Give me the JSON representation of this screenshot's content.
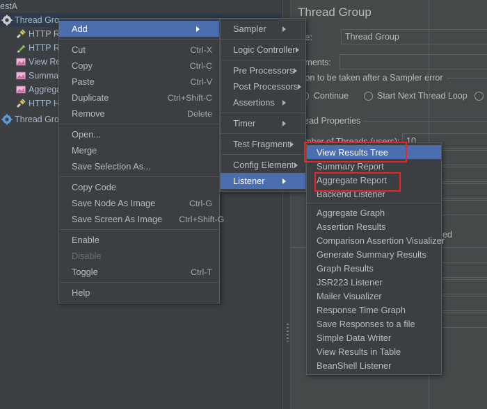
{
  "app": {
    "tree_root_label": "estA"
  },
  "tree": {
    "items": [
      {
        "label": "Thread Group",
        "icon": "gear-icon",
        "selected": true,
        "indent": 0
      },
      {
        "label": "HTTP Re",
        "icon": "http-request-icon",
        "selected": false,
        "indent": 1
      },
      {
        "label": "HTTP Re",
        "icon": "http-request-defaults-icon",
        "selected": false,
        "indent": 1
      },
      {
        "label": "View Res",
        "icon": "listener-icon",
        "selected": false,
        "indent": 1
      },
      {
        "label": "Summar",
        "icon": "listener-icon",
        "selected": false,
        "indent": 1
      },
      {
        "label": "Aggrega",
        "icon": "listener-icon",
        "selected": false,
        "indent": 1
      },
      {
        "label": "HTTP He",
        "icon": "http-header-manager-icon",
        "selected": false,
        "indent": 1
      },
      {
        "label": "Thread Grou",
        "icon": "gear-blue-icon",
        "selected": false,
        "indent": 0
      }
    ]
  },
  "config": {
    "title": "Thread Group",
    "name_label": "me:",
    "name_value": "Thread Group",
    "comments_label": "mments:",
    "comments_value": "",
    "sampler_error_group": "ction to be taken after a Sampler error",
    "radio_continue": "Continue",
    "radio_start_next_loop": "Start Next Thread Loop",
    "thread_properties_group": "hread Properties",
    "num_threads_label": "Jumber of Threads (users):",
    "num_threads_value": "10",
    "forever_partial": "ed"
  },
  "context_menu": {
    "items": [
      {
        "label": "Add",
        "accel": "",
        "submenu": true,
        "selected": true,
        "disabled": false
      },
      {
        "separator": true
      },
      {
        "label": "Cut",
        "accel": "Ctrl-X",
        "submenu": false,
        "selected": false,
        "disabled": false
      },
      {
        "label": "Copy",
        "accel": "Ctrl-C",
        "submenu": false,
        "selected": false,
        "disabled": false
      },
      {
        "label": "Paste",
        "accel": "Ctrl-V",
        "submenu": false,
        "selected": false,
        "disabled": false
      },
      {
        "label": "Duplicate",
        "accel": "Ctrl+Shift-C",
        "submenu": false,
        "selected": false,
        "disabled": false
      },
      {
        "label": "Remove",
        "accel": "Delete",
        "submenu": false,
        "selected": false,
        "disabled": false
      },
      {
        "separator": true
      },
      {
        "label": "Open...",
        "accel": "",
        "submenu": false,
        "selected": false,
        "disabled": false
      },
      {
        "label": "Merge",
        "accel": "",
        "submenu": false,
        "selected": false,
        "disabled": false
      },
      {
        "label": "Save Selection As...",
        "accel": "",
        "submenu": false,
        "selected": false,
        "disabled": false
      },
      {
        "separator": true
      },
      {
        "label": "Copy Code",
        "accel": "",
        "submenu": false,
        "selected": false,
        "disabled": false
      },
      {
        "label": "Save Node As Image",
        "accel": "Ctrl-G",
        "submenu": false,
        "selected": false,
        "disabled": false
      },
      {
        "label": "Save Screen As Image",
        "accel": "Ctrl+Shift-G",
        "submenu": false,
        "selected": false,
        "disabled": false
      },
      {
        "separator": true
      },
      {
        "label": "Enable",
        "accel": "",
        "submenu": false,
        "selected": false,
        "disabled": false
      },
      {
        "label": "Disable",
        "accel": "",
        "submenu": false,
        "selected": false,
        "disabled": true
      },
      {
        "label": "Toggle",
        "accel": "Ctrl-T",
        "submenu": false,
        "selected": false,
        "disabled": false
      },
      {
        "separator": true
      },
      {
        "label": "Help",
        "accel": "",
        "submenu": false,
        "selected": false,
        "disabled": false
      }
    ]
  },
  "add_submenu": {
    "items": [
      {
        "label": "Sampler",
        "submenu": true,
        "selected": false
      },
      {
        "separator": true
      },
      {
        "label": "Logic Controller",
        "submenu": true,
        "selected": false
      },
      {
        "separator": true
      },
      {
        "label": "Pre Processors",
        "submenu": true,
        "selected": false
      },
      {
        "label": "Post Processors",
        "submenu": true,
        "selected": false
      },
      {
        "label": "Assertions",
        "submenu": true,
        "selected": false
      },
      {
        "separator": true
      },
      {
        "label": "Timer",
        "submenu": true,
        "selected": false
      },
      {
        "separator": true
      },
      {
        "label": "Test Fragment",
        "submenu": true,
        "selected": false
      },
      {
        "separator": true
      },
      {
        "label": "Config Element",
        "submenu": true,
        "selected": false
      },
      {
        "label": "Listener",
        "submenu": true,
        "selected": true
      }
    ]
  },
  "listener_submenu": {
    "items": [
      {
        "label": "View Results Tree",
        "selected": true,
        "highlighted": true
      },
      {
        "label": "Summary Report",
        "selected": false,
        "highlighted": false
      },
      {
        "label": "Aggregate Report",
        "selected": false,
        "highlighted": true
      },
      {
        "label": "Backend Listener",
        "selected": false,
        "highlighted": false
      },
      {
        "separator": true
      },
      {
        "label": "Aggregate Graph",
        "selected": false,
        "highlighted": false
      },
      {
        "label": "Assertion Results",
        "selected": false,
        "highlighted": false
      },
      {
        "label": "Comparison Assertion Visualizer",
        "selected": false,
        "highlighted": false
      },
      {
        "label": "Generate Summary Results",
        "selected": false,
        "highlighted": false
      },
      {
        "label": "Graph Results",
        "selected": false,
        "highlighted": false
      },
      {
        "label": "JSR223 Listener",
        "selected": false,
        "highlighted": false
      },
      {
        "label": "Mailer Visualizer",
        "selected": false,
        "highlighted": false
      },
      {
        "label": "Response Time Graph",
        "selected": false,
        "highlighted": false
      },
      {
        "label": "Save Responses to a file",
        "selected": false,
        "highlighted": false
      },
      {
        "label": "Simple Data Writer",
        "selected": false,
        "highlighted": false
      },
      {
        "label": "View Results in Table",
        "selected": false,
        "highlighted": false
      },
      {
        "label": "BeanShell Listener",
        "selected": false,
        "highlighted": false
      }
    ]
  },
  "colors": {
    "menu_bg": "#3c3f41",
    "panel_bg": "#45494a",
    "tree_bg": "#3c4043",
    "highlight": "#4b6eaf",
    "annotation": "#ef2323",
    "text": "#bbbbbb",
    "tree_text": "#a9b7c6"
  }
}
